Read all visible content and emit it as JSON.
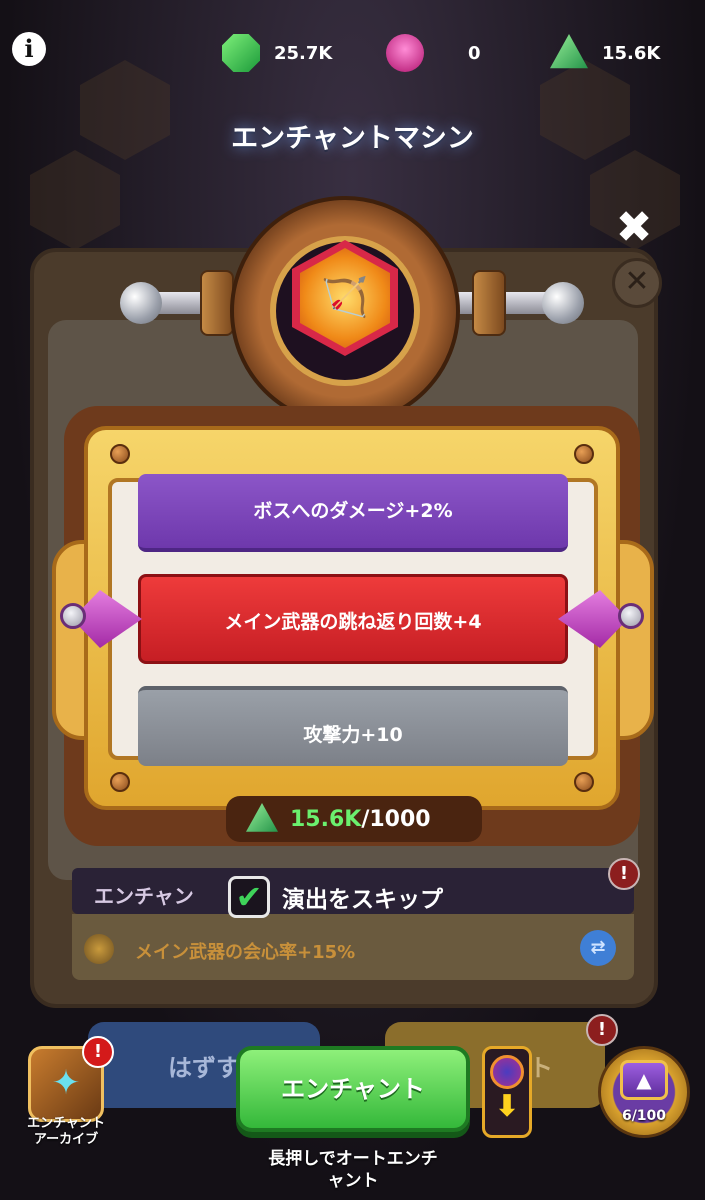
{
  "header": {
    "title": "エンチャントマシン",
    "currencies": [
      {
        "icon": "green-gem-icon",
        "value": "25.7K"
      },
      {
        "icon": "pink-gem-icon",
        "value": "0"
      },
      {
        "icon": "enchant-stone-icon",
        "value": "15.6K"
      }
    ]
  },
  "options": {
    "top": "ボスへのダメージ+2%",
    "selected": "メイン武器の跳ね返り回数+4",
    "bottom": "攻撃力+10"
  },
  "cost": {
    "have": "15.6K",
    "need": "/1000"
  },
  "skip": {
    "label": "演出をスキップ",
    "checked": true
  },
  "background": {
    "row_header": "エンチャン",
    "row_text": "メイン武器の会心率+15%",
    "left_button": "はずす",
    "right_button": "ント"
  },
  "footer": {
    "archive_label_line1": "エンチャント",
    "archive_label_line2": "アーカイブ",
    "enchant_button": "エンチャント",
    "hint_line1": "長押しでオートエンチ",
    "hint_line2": "ャント",
    "chest_count": "6/100",
    "alert_mark": "!"
  },
  "colors": {
    "selected_option": "#d8262c",
    "top_option": "#7a44b8",
    "bottom_option": "#8a8e96",
    "enchant_button": "#46c443",
    "cost_have": "#6bf06e"
  }
}
